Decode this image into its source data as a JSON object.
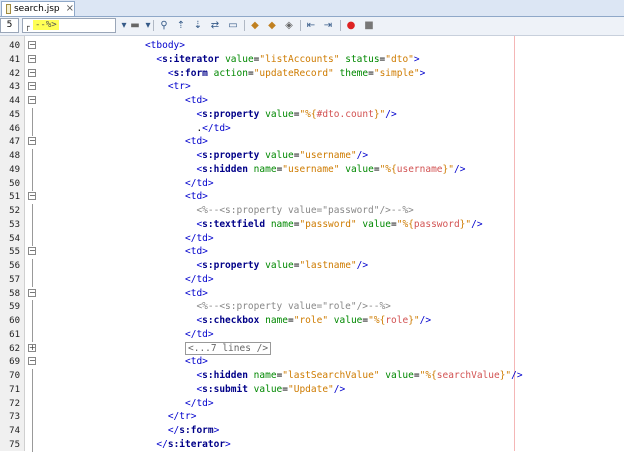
{
  "tab": {
    "title": "search.jsp",
    "close": "×"
  },
  "toolbar": {
    "line_number": "5",
    "combo_text": "--%>",
    "buttons": [
      "dropdown-arrow-icon",
      "history-icon",
      "dropdown-arrow-icon",
      "find-icon",
      "find-prev-icon",
      "find-next-icon",
      "replace-icon",
      "toggle-highlight-icon",
      "bookmark-prev-icon",
      "bookmark-next-icon",
      "toggle-bookmark-icon",
      "shift-left-icon",
      "shift-right-icon",
      "record-macro-icon",
      "stop-macro-icon"
    ]
  },
  "lines": [
    {
      "n": "40",
      "fold": "−",
      "indent": 18,
      "parts": [
        [
          "tag",
          "<tbody>"
        ]
      ]
    },
    {
      "n": "41",
      "fold": "−",
      "indent": 20,
      "parts": [
        [
          "tag",
          "<"
        ],
        [
          "tagb",
          "s:iterator"
        ],
        [
          "txt",
          " "
        ],
        [
          "attr",
          "value"
        ],
        [
          "txt",
          "="
        ],
        [
          "val",
          "\"listAccounts\""
        ],
        [
          "txt",
          " "
        ],
        [
          "attr",
          "status"
        ],
        [
          "txt",
          "="
        ],
        [
          "val",
          "\"dto\""
        ],
        [
          "tag",
          ">"
        ]
      ]
    },
    {
      "n": "42",
      "fold": "−",
      "indent": 22,
      "parts": [
        [
          "tag",
          "<"
        ],
        [
          "tagb",
          "s:form"
        ],
        [
          "txt",
          " "
        ],
        [
          "attr",
          "action"
        ],
        [
          "txt",
          "="
        ],
        [
          "val",
          "\"updateRecord\""
        ],
        [
          "txt",
          " "
        ],
        [
          "attr",
          "theme"
        ],
        [
          "txt",
          "="
        ],
        [
          "val",
          "\"simple\""
        ],
        [
          "tag",
          ">"
        ]
      ]
    },
    {
      "n": "43",
      "fold": "−",
      "indent": 22,
      "parts": [
        [
          "tag",
          "<tr>"
        ]
      ]
    },
    {
      "n": "44",
      "fold": "−",
      "indent": 25,
      "parts": [
        [
          "tag",
          "<td>"
        ]
      ]
    },
    {
      "n": "45",
      "fold": "",
      "indent": 27,
      "parts": [
        [
          "tag",
          "<"
        ],
        [
          "tagb",
          "s:property"
        ],
        [
          "txt",
          " "
        ],
        [
          "attr",
          "value"
        ],
        [
          "txt",
          "="
        ],
        [
          "val",
          "\"%{"
        ],
        [
          "el",
          "#dto.count"
        ],
        [
          "val",
          "}\""
        ],
        [
          "tag",
          "/>"
        ]
      ]
    },
    {
      "n": "46",
      "fold": "",
      "indent": 27,
      "parts": [
        [
          "txt",
          "."
        ],
        [
          "tag",
          "</td>"
        ]
      ]
    },
    {
      "n": "47",
      "fold": "−",
      "indent": 25,
      "parts": [
        [
          "tag",
          "<td>"
        ]
      ]
    },
    {
      "n": "48",
      "fold": "",
      "indent": 27,
      "parts": [
        [
          "tag",
          "<"
        ],
        [
          "tagb",
          "s:property"
        ],
        [
          "txt",
          " "
        ],
        [
          "attr",
          "value"
        ],
        [
          "txt",
          "="
        ],
        [
          "val",
          "\"username\""
        ],
        [
          "tag",
          "/>"
        ]
      ]
    },
    {
      "n": "49",
      "fold": "",
      "indent": 27,
      "parts": [
        [
          "tag",
          "<"
        ],
        [
          "tagb",
          "s:hidden"
        ],
        [
          "txt",
          " "
        ],
        [
          "attr",
          "name"
        ],
        [
          "txt",
          "="
        ],
        [
          "val",
          "\"username\""
        ],
        [
          "txt",
          " "
        ],
        [
          "attr",
          "value"
        ],
        [
          "txt",
          "="
        ],
        [
          "val",
          "\"%{"
        ],
        [
          "el",
          "username"
        ],
        [
          "val",
          "}\""
        ],
        [
          "tag",
          "/>"
        ]
      ]
    },
    {
      "n": "50",
      "fold": "",
      "indent": 25,
      "parts": [
        [
          "tag",
          "</td>"
        ]
      ]
    },
    {
      "n": "51",
      "fold": "−",
      "indent": 25,
      "parts": [
        [
          "tag",
          "<td>"
        ]
      ]
    },
    {
      "n": "52",
      "fold": "",
      "indent": 27,
      "parts": [
        [
          "cmt",
          "<%--<s:property value=\"password\"/>--%>"
        ]
      ]
    },
    {
      "n": "53",
      "fold": "",
      "indent": 27,
      "parts": [
        [
          "tag",
          "<"
        ],
        [
          "tagb",
          "s:textfield"
        ],
        [
          "txt",
          " "
        ],
        [
          "attr",
          "name"
        ],
        [
          "txt",
          "="
        ],
        [
          "val",
          "\"password\""
        ],
        [
          "txt",
          " "
        ],
        [
          "attr",
          "value"
        ],
        [
          "txt",
          "="
        ],
        [
          "val",
          "\"%{"
        ],
        [
          "el",
          "password"
        ],
        [
          "val",
          "}\""
        ],
        [
          "tag",
          "/>"
        ]
      ]
    },
    {
      "n": "54",
      "fold": "",
      "indent": 25,
      "parts": [
        [
          "tag",
          "</td>"
        ]
      ]
    },
    {
      "n": "55",
      "fold": "−",
      "indent": 25,
      "parts": [
        [
          "tag",
          "<td>"
        ]
      ]
    },
    {
      "n": "56",
      "fold": "",
      "indent": 27,
      "parts": [
        [
          "tag",
          "<"
        ],
        [
          "tagb",
          "s:property"
        ],
        [
          "txt",
          " "
        ],
        [
          "attr",
          "value"
        ],
        [
          "txt",
          "="
        ],
        [
          "val",
          "\"lastname\""
        ],
        [
          "tag",
          "/>"
        ]
      ]
    },
    {
      "n": "57",
      "fold": "",
      "indent": 25,
      "parts": [
        [
          "tag",
          "</td>"
        ]
      ]
    },
    {
      "n": "58",
      "fold": "−",
      "indent": 25,
      "parts": [
        [
          "tag",
          "<td>"
        ]
      ]
    },
    {
      "n": "59",
      "fold": "",
      "indent": 27,
      "parts": [
        [
          "cmt",
          "<%--<s:property value=\"role\"/>--%>"
        ]
      ]
    },
    {
      "n": "60",
      "fold": "",
      "indent": 27,
      "parts": [
        [
          "tag",
          "<"
        ],
        [
          "tagb",
          "s:checkbox"
        ],
        [
          "txt",
          " "
        ],
        [
          "attr",
          "name"
        ],
        [
          "txt",
          "="
        ],
        [
          "val",
          "\"role\""
        ],
        [
          "txt",
          " "
        ],
        [
          "attr",
          "value"
        ],
        [
          "txt",
          "="
        ],
        [
          "val",
          "\"%{"
        ],
        [
          "el",
          "role"
        ],
        [
          "val",
          "}\""
        ],
        [
          "tag",
          "/>"
        ]
      ]
    },
    {
      "n": "61",
      "fold": "",
      "indent": 25,
      "parts": [
        [
          "tag",
          "</td>"
        ]
      ]
    },
    {
      "n": "62",
      "fold": "+",
      "indent": 25,
      "parts": [
        [
          "collapsed",
          "<...7 lines />"
        ]
      ]
    },
    {
      "n": "69",
      "fold": "−",
      "indent": 25,
      "parts": [
        [
          "tag",
          "<td>"
        ]
      ]
    },
    {
      "n": "70",
      "fold": "",
      "indent": 27,
      "parts": [
        [
          "tag",
          "<"
        ],
        [
          "tagb",
          "s:hidden"
        ],
        [
          "txt",
          " "
        ],
        [
          "attr",
          "name"
        ],
        [
          "txt",
          "="
        ],
        [
          "val",
          "\"lastSearchValue\""
        ],
        [
          "txt",
          " "
        ],
        [
          "attr",
          "value"
        ],
        [
          "txt",
          "="
        ],
        [
          "val",
          "\"%{"
        ],
        [
          "el",
          "searchValue"
        ],
        [
          "val",
          "}\""
        ],
        [
          "tag",
          "/>"
        ]
      ]
    },
    {
      "n": "71",
      "fold": "",
      "indent": 27,
      "parts": [
        [
          "tag",
          "<"
        ],
        [
          "tagb",
          "s:submit"
        ],
        [
          "txt",
          " "
        ],
        [
          "attr",
          "value"
        ],
        [
          "txt",
          "="
        ],
        [
          "val",
          "\"Update\""
        ],
        [
          "tag",
          "/>"
        ]
      ]
    },
    {
      "n": "72",
      "fold": "",
      "indent": 25,
      "parts": [
        [
          "tag",
          "</td>"
        ]
      ]
    },
    {
      "n": "73",
      "fold": "",
      "indent": 22,
      "parts": [
        [
          "tag",
          "</tr>"
        ]
      ]
    },
    {
      "n": "74",
      "fold": "",
      "indent": 22,
      "parts": [
        [
          "tag",
          "</"
        ],
        [
          "tagb",
          "s:form"
        ],
        [
          "tag",
          ">"
        ]
      ]
    },
    {
      "n": "75",
      "fold": "",
      "indent": 20,
      "parts": [
        [
          "tag",
          "</"
        ],
        [
          "tagb",
          "s:iterator"
        ],
        [
          "tag",
          ">"
        ]
      ]
    }
  ]
}
